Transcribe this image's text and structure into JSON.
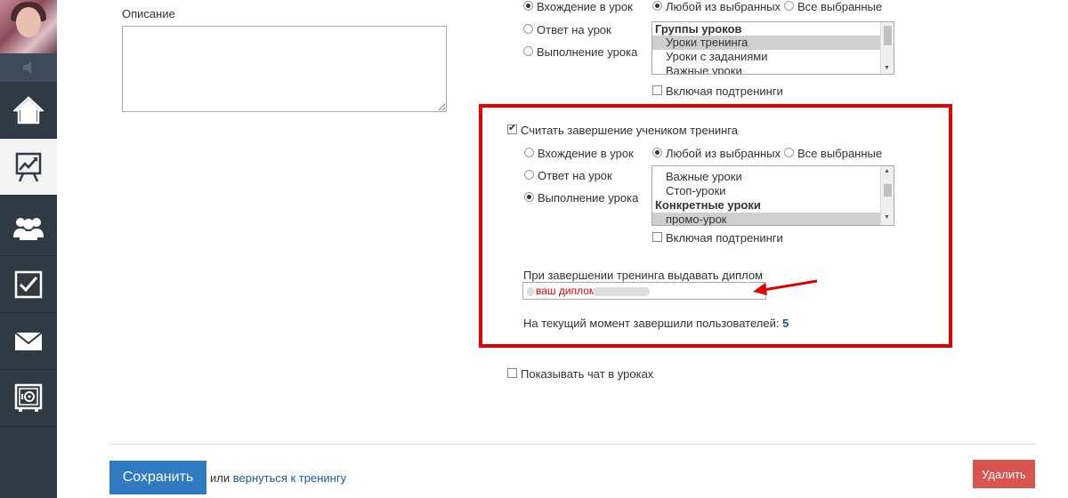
{
  "sidebar": {
    "items": [
      {
        "icon": "home-icon"
      },
      {
        "icon": "chart-board-icon",
        "active": true
      },
      {
        "icon": "users-icon"
      },
      {
        "icon": "checkbox-icon"
      },
      {
        "icon": "mail-icon"
      },
      {
        "icon": "safe-icon"
      }
    ]
  },
  "form": {
    "description_label": "Описание",
    "top_rules": {
      "radio_entry": "Вхождение в урок",
      "radio_answer": "Ответ на урок",
      "radio_complete": "Выполнение урока",
      "radio_any": "Любой из выбранных",
      "radio_all": "Все выбранные",
      "list_items": [
        {
          "label": "Группы уроков",
          "group": true
        },
        {
          "label": "Уроки тренинга",
          "selected": true
        },
        {
          "label": "Уроки с заданиями"
        },
        {
          "label": "Важные уроки"
        }
      ],
      "include_subtrainings": "Включая подтренинги"
    },
    "completion": {
      "checkbox_label": "Считать завершение учеником тренинга",
      "radio_entry": "Вхождение в урок",
      "radio_answer": "Ответ на урок",
      "radio_complete": "Выполнение урока",
      "radio_any": "Любой из выбранных",
      "radio_all": "Все выбранные",
      "list_items": [
        {
          "label": "Важные уроки"
        },
        {
          "label": "Стоп-уроки"
        },
        {
          "label": "Конкретные уроки",
          "group": true
        },
        {
          "label": "промо-урок",
          "selected": true
        }
      ],
      "include_subtrainings": "Включая подтренинги",
      "diploma_label": "При завершении тренинга выдавать диплом",
      "diploma_value": "ваш диплом",
      "completed_label": "На текущий момент завершили пользователей:",
      "completed_count": "5"
    },
    "show_chat": "Показывать чат в уроках"
  },
  "footer": {
    "save_label": "Сохранить",
    "or_text": "или",
    "back_link": "вернуться к тренингу",
    "delete_label": "Удалить"
  },
  "colors": {
    "highlight_box": "#e00000",
    "arrow": "#e00000",
    "save_button": "#2f7ac0",
    "delete_button": "#d9534f",
    "sidebar": "#2f3a45"
  }
}
